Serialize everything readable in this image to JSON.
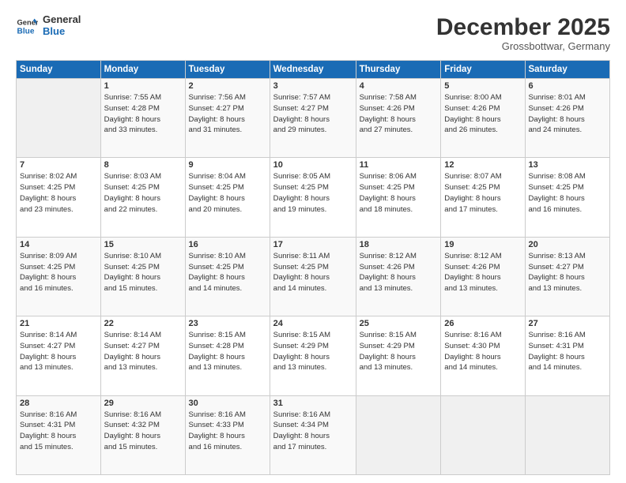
{
  "logo": {
    "line1": "General",
    "line2": "Blue"
  },
  "header": {
    "month": "December 2025",
    "location": "Grossbottwar, Germany"
  },
  "weekdays": [
    "Sunday",
    "Monday",
    "Tuesday",
    "Wednesday",
    "Thursday",
    "Friday",
    "Saturday"
  ],
  "weeks": [
    [
      {
        "day": "",
        "info": ""
      },
      {
        "day": "1",
        "info": "Sunrise: 7:55 AM\nSunset: 4:28 PM\nDaylight: 8 hours\nand 33 minutes."
      },
      {
        "day": "2",
        "info": "Sunrise: 7:56 AM\nSunset: 4:27 PM\nDaylight: 8 hours\nand 31 minutes."
      },
      {
        "day": "3",
        "info": "Sunrise: 7:57 AM\nSunset: 4:27 PM\nDaylight: 8 hours\nand 29 minutes."
      },
      {
        "day": "4",
        "info": "Sunrise: 7:58 AM\nSunset: 4:26 PM\nDaylight: 8 hours\nand 27 minutes."
      },
      {
        "day": "5",
        "info": "Sunrise: 8:00 AM\nSunset: 4:26 PM\nDaylight: 8 hours\nand 26 minutes."
      },
      {
        "day": "6",
        "info": "Sunrise: 8:01 AM\nSunset: 4:26 PM\nDaylight: 8 hours\nand 24 minutes."
      }
    ],
    [
      {
        "day": "7",
        "info": "Sunrise: 8:02 AM\nSunset: 4:25 PM\nDaylight: 8 hours\nand 23 minutes."
      },
      {
        "day": "8",
        "info": "Sunrise: 8:03 AM\nSunset: 4:25 PM\nDaylight: 8 hours\nand 22 minutes."
      },
      {
        "day": "9",
        "info": "Sunrise: 8:04 AM\nSunset: 4:25 PM\nDaylight: 8 hours\nand 20 minutes."
      },
      {
        "day": "10",
        "info": "Sunrise: 8:05 AM\nSunset: 4:25 PM\nDaylight: 8 hours\nand 19 minutes."
      },
      {
        "day": "11",
        "info": "Sunrise: 8:06 AM\nSunset: 4:25 PM\nDaylight: 8 hours\nand 18 minutes."
      },
      {
        "day": "12",
        "info": "Sunrise: 8:07 AM\nSunset: 4:25 PM\nDaylight: 8 hours\nand 17 minutes."
      },
      {
        "day": "13",
        "info": "Sunrise: 8:08 AM\nSunset: 4:25 PM\nDaylight: 8 hours\nand 16 minutes."
      }
    ],
    [
      {
        "day": "14",
        "info": "Sunrise: 8:09 AM\nSunset: 4:25 PM\nDaylight: 8 hours\nand 16 minutes."
      },
      {
        "day": "15",
        "info": "Sunrise: 8:10 AM\nSunset: 4:25 PM\nDaylight: 8 hours\nand 15 minutes."
      },
      {
        "day": "16",
        "info": "Sunrise: 8:10 AM\nSunset: 4:25 PM\nDaylight: 8 hours\nand 14 minutes."
      },
      {
        "day": "17",
        "info": "Sunrise: 8:11 AM\nSunset: 4:25 PM\nDaylight: 8 hours\nand 14 minutes."
      },
      {
        "day": "18",
        "info": "Sunrise: 8:12 AM\nSunset: 4:26 PM\nDaylight: 8 hours\nand 13 minutes."
      },
      {
        "day": "19",
        "info": "Sunrise: 8:12 AM\nSunset: 4:26 PM\nDaylight: 8 hours\nand 13 minutes."
      },
      {
        "day": "20",
        "info": "Sunrise: 8:13 AM\nSunset: 4:27 PM\nDaylight: 8 hours\nand 13 minutes."
      }
    ],
    [
      {
        "day": "21",
        "info": "Sunrise: 8:14 AM\nSunset: 4:27 PM\nDaylight: 8 hours\nand 13 minutes."
      },
      {
        "day": "22",
        "info": "Sunrise: 8:14 AM\nSunset: 4:27 PM\nDaylight: 8 hours\nand 13 minutes."
      },
      {
        "day": "23",
        "info": "Sunrise: 8:15 AM\nSunset: 4:28 PM\nDaylight: 8 hours\nand 13 minutes."
      },
      {
        "day": "24",
        "info": "Sunrise: 8:15 AM\nSunset: 4:29 PM\nDaylight: 8 hours\nand 13 minutes."
      },
      {
        "day": "25",
        "info": "Sunrise: 8:15 AM\nSunset: 4:29 PM\nDaylight: 8 hours\nand 13 minutes."
      },
      {
        "day": "26",
        "info": "Sunrise: 8:16 AM\nSunset: 4:30 PM\nDaylight: 8 hours\nand 14 minutes."
      },
      {
        "day": "27",
        "info": "Sunrise: 8:16 AM\nSunset: 4:31 PM\nDaylight: 8 hours\nand 14 minutes."
      }
    ],
    [
      {
        "day": "28",
        "info": "Sunrise: 8:16 AM\nSunset: 4:31 PM\nDaylight: 8 hours\nand 15 minutes."
      },
      {
        "day": "29",
        "info": "Sunrise: 8:16 AM\nSunset: 4:32 PM\nDaylight: 8 hours\nand 15 minutes."
      },
      {
        "day": "30",
        "info": "Sunrise: 8:16 AM\nSunset: 4:33 PM\nDaylight: 8 hours\nand 16 minutes."
      },
      {
        "day": "31",
        "info": "Sunrise: 8:16 AM\nSunset: 4:34 PM\nDaylight: 8 hours\nand 17 minutes."
      },
      {
        "day": "",
        "info": ""
      },
      {
        "day": "",
        "info": ""
      },
      {
        "day": "",
        "info": ""
      }
    ]
  ]
}
